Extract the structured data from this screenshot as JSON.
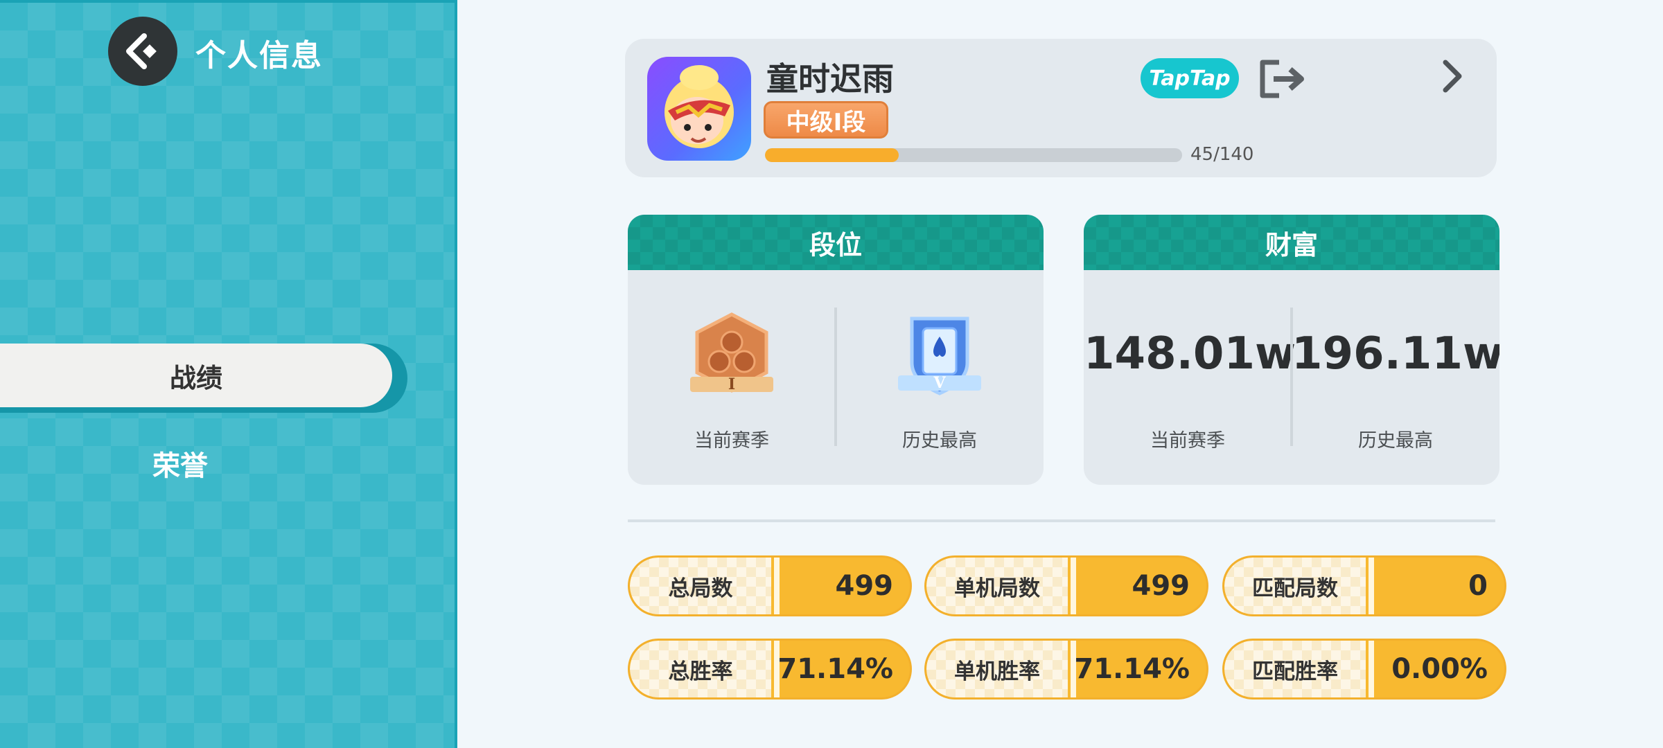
{
  "header": {
    "title": "个人信息"
  },
  "sidebar": {
    "items": [
      {
        "label": "战绩",
        "active": true
      },
      {
        "label": "荣誉",
        "active": false
      }
    ]
  },
  "profile": {
    "username": "童时迟雨",
    "rank": "中级I段",
    "progress_text": "45/140",
    "progress_fraction": 0.321,
    "platform_badge": "TapTap",
    "icons": [
      "back-icon",
      "logout-icon",
      "chevron-right-icon"
    ]
  },
  "rank_panel": {
    "title": "段位",
    "current": {
      "label": "当前赛季",
      "medal_roman": "I"
    },
    "best": {
      "label": "历史最高",
      "medal_roman": "V"
    }
  },
  "wealth_panel": {
    "title": "财富",
    "current": {
      "label": "当前赛季",
      "value": "148.01w"
    },
    "best": {
      "label": "历史最高",
      "value": "196.11w"
    }
  },
  "stats": [
    {
      "label": "总局数",
      "value": "499"
    },
    {
      "label": "单机局数",
      "value": "499"
    },
    {
      "label": "匹配局数",
      "value": "0"
    },
    {
      "label": "总胜率",
      "value": "71.14%"
    },
    {
      "label": "单机胜率",
      "value": "71.14%"
    },
    {
      "label": "匹配胜率",
      "value": "0.00%"
    }
  ],
  "colors": {
    "sidebar_bg": "#3ab8c9",
    "panel_header": "#17a293",
    "pill_accent": "#f8b930",
    "rank_badge": "#ee8a47",
    "taptap": "#17c6cf"
  }
}
